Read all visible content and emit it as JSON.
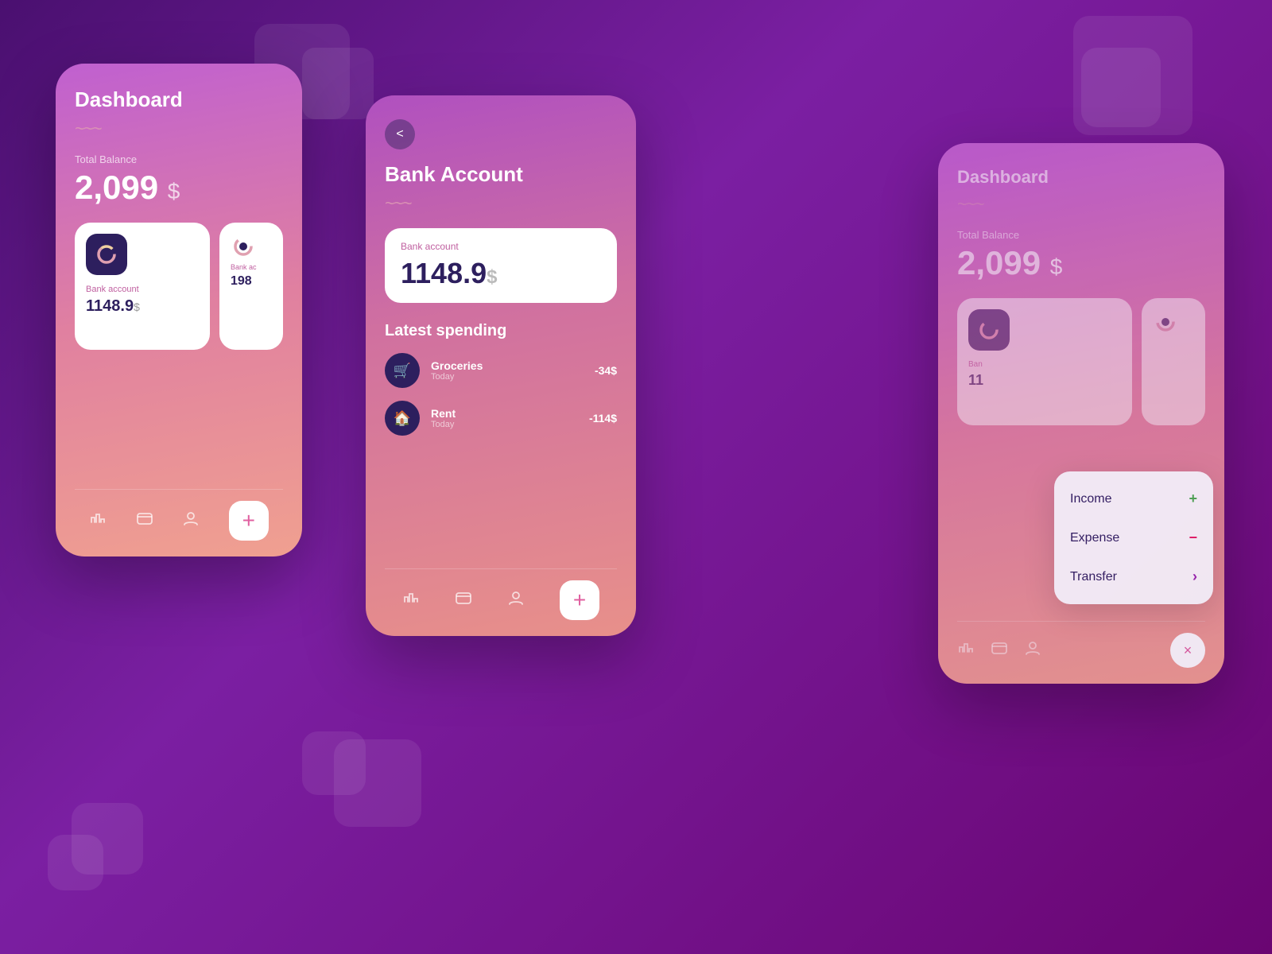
{
  "background": {
    "color1": "#4a1070",
    "color2": "#7b1fa2",
    "color3": "#6a0572"
  },
  "screen_left": {
    "title": "Dashboard",
    "wavy": "~~~",
    "balance_label": "Total Balance",
    "balance_amount": "2,099",
    "balance_dollar": "$",
    "cards": [
      {
        "label": "Bank account",
        "amount": "1148.9",
        "dollar": "$"
      },
      {
        "label": "Bank ac",
        "amount": "198",
        "dollar": ""
      }
    ],
    "nav": {
      "icon1": "📊",
      "icon2": "💳",
      "icon3": "👤",
      "plus": "+"
    }
  },
  "screen_middle": {
    "back_icon": "<",
    "title": "Bank Account",
    "wavy": "~~~",
    "balance_card": {
      "label": "Bank account",
      "amount": "1148.9",
      "dollar": "$"
    },
    "latest_spending_title": "Latest spending",
    "spendings": [
      {
        "name": "Groceries",
        "date": "Today",
        "amount": "-34$",
        "icon": "🛒"
      },
      {
        "name": "Rent",
        "date": "Today",
        "amount": "-114$",
        "icon": "🏠"
      }
    ],
    "nav": {
      "icon1": "📊",
      "icon2": "💳",
      "icon3": "👤",
      "plus": "+"
    }
  },
  "screen_right": {
    "title": "Dashboard",
    "wavy": "~~~",
    "balance_label": "Total Balance",
    "balance_amount": "2,099",
    "balance_dollar": "$",
    "bank_label": "Ban",
    "bank_amount": "11",
    "popup": {
      "items": [
        {
          "label": "Income",
          "icon": "+",
          "icon_class": "green"
        },
        {
          "label": "Expense",
          "icon": "−",
          "icon_class": "red"
        },
        {
          "label": "Transfer",
          "icon": "›",
          "icon_class": "purple"
        }
      ],
      "close_icon": "×"
    },
    "nav": {
      "icon1": "📊",
      "icon2": "💳",
      "icon3": "👤"
    }
  }
}
